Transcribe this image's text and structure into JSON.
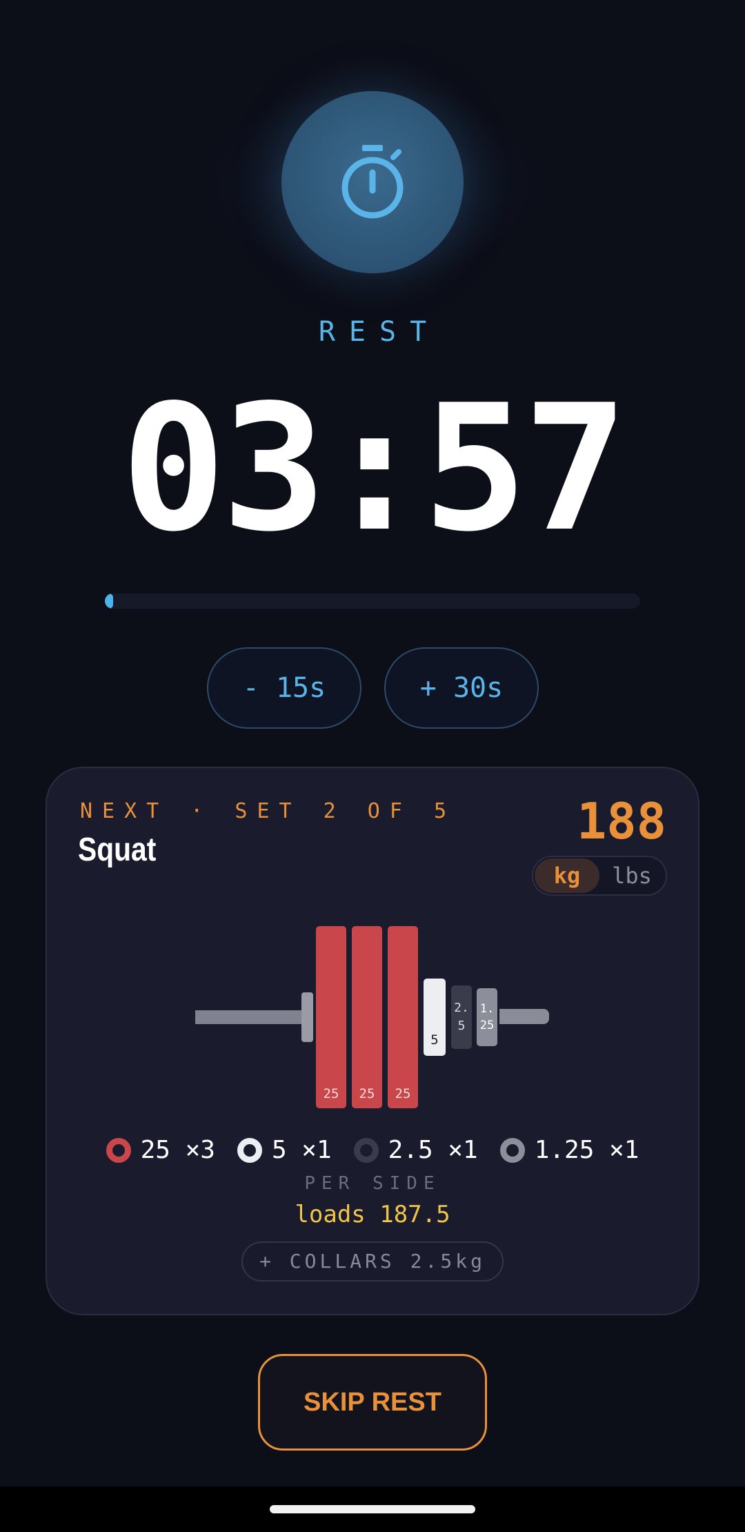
{
  "rest_label": "REST",
  "timer": "03:57",
  "progress": {
    "fraction": 0.01,
    "color": "#4fb2ea"
  },
  "adjust_buttons": {
    "minus": "- 15s",
    "plus": "+ 30s"
  },
  "next": {
    "label": "NEXT · SET 2 OF 5",
    "exercise": "Squat",
    "weight": "188",
    "units": {
      "active": "kg",
      "inactive": "lbs"
    }
  },
  "barbell": {
    "plates": [
      "25",
      "25",
      "25",
      "5",
      "2.5",
      "1.25"
    ]
  },
  "legend": [
    {
      "label": "25 ×3",
      "color": "#c9474a",
      "icon": "red-plate-icon"
    },
    {
      "label": "5 ×1",
      "color": "#eceef2",
      "icon": "white-plate-icon"
    },
    {
      "label": "2.5 ×1",
      "color": "#3a3c4c",
      "icon": "dark-plate-icon"
    },
    {
      "label": "1.25 ×1",
      "color": "#8c8e9a",
      "icon": "grey-plate-icon"
    }
  ],
  "per_side": "PER SIDE",
  "loads": "loads 187.5",
  "collars_button": "+ COLLARS 2.5kg",
  "skip_button": "SKIP REST",
  "colors": {
    "accent_blue": "#5ab4e8",
    "accent_orange": "#e8913a",
    "loads_yellow": "#f1c44a",
    "background": "#0c0e18"
  },
  "icon": "stopwatch-icon"
}
